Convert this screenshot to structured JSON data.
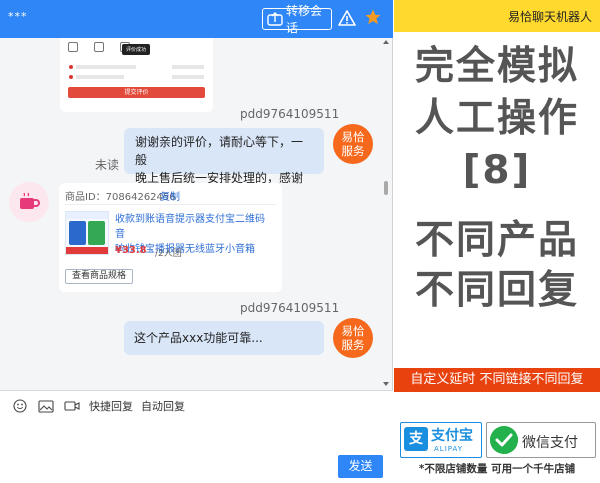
{
  "header": {
    "title": "***",
    "transfer_label": "转移会话"
  },
  "review_card": {
    "tooltip": "评价成功",
    "submit_label": "提交评价"
  },
  "messages": [
    {
      "sender": "pdd9764109511",
      "text_line1": "谢谢亲的评价，请耐心等下，一般",
      "text_line2": "晚上售后统一安排处理的，感谢",
      "avatar_line1": "易恰",
      "avatar_line2": "服务"
    },
    {
      "sender": "pdd9764109511",
      "text": "这个产品xxx功能可靠...",
      "avatar_line1": "易恰",
      "avatar_line2": "服务"
    }
  ],
  "unread_label": "未读",
  "product": {
    "id_label": "商品ID：70864262456",
    "copy_label": "复制",
    "name_line1": "收款到账语音提示器支付宝二维码音",
    "name_line2": "响收钱宝播报器无线蓝牙小音箱",
    "price": "¥33.8",
    "deal": "/2人团",
    "spec_label": "查看商品规格"
  },
  "toolbar": {
    "quick_reply": "快捷回复",
    "auto_reply": "自动回复",
    "send_label": "发送"
  },
  "promo": {
    "brand": "易恰聊天机器人",
    "line1": "完全模拟",
    "line2": "人工操作",
    "line3": "[8]",
    "line4": "不同产品",
    "line5": "不同回复",
    "red_banner": "自定义延时 不同链接不同回复",
    "alipay_zh": "支付宝",
    "alipay_en": "ALIPAY",
    "wechat_pay": "微信支付",
    "footer": "*不限店铺数量 可用一个千牛店铺"
  },
  "colors": {
    "header_blue": "#2f86f6",
    "bubble_blue": "#d9e6f8",
    "bot_orange": "#f6691d",
    "promo_yellow": "#ffd92e",
    "promo_red": "#e8420f",
    "alipay_blue": "#1a8fe0",
    "wechat_green": "#22b14c"
  }
}
